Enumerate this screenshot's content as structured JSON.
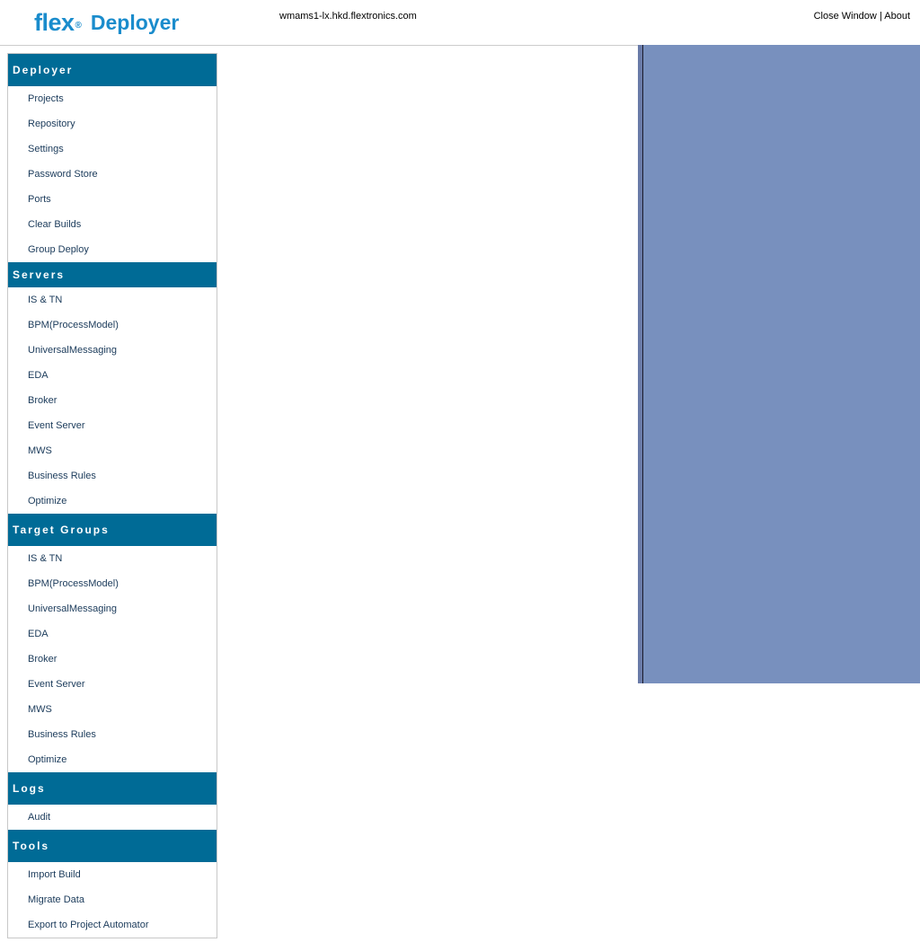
{
  "header": {
    "logo_text": "flex",
    "logo_dot": "®",
    "app_title": "Deployer",
    "hostname": "wmams1-lx.hkd.flextronics.com",
    "close_window": "Close Window",
    "separator": "|",
    "about": "About"
  },
  "colors": {
    "brand": "#1a8ccc",
    "section_header_bg": "#006b96",
    "right_panel_bg": "#7890be"
  },
  "sidebar": {
    "deployer": {
      "title": "Deployer",
      "items": [
        "Projects",
        "Repository",
        "Settings",
        "Password Store",
        "Ports",
        "Clear Builds",
        "Group Deploy"
      ]
    },
    "servers": {
      "title": "Servers",
      "items": [
        "IS & TN",
        "BPM(ProcessModel)",
        "UniversalMessaging",
        "EDA",
        "Broker",
        "Event Server",
        "MWS",
        "Business Rules",
        "Optimize"
      ]
    },
    "target_groups": {
      "title": "Target Groups",
      "items": [
        "IS & TN",
        "BPM(ProcessModel)",
        "UniversalMessaging",
        "EDA",
        "Broker",
        "Event Server",
        "MWS",
        "Business Rules",
        "Optimize"
      ]
    },
    "logs": {
      "title": "Logs",
      "items": [
        "Audit"
      ]
    },
    "tools": {
      "title": "Tools",
      "items": [
        "Import Build",
        "Migrate Data",
        "Export to Project Automator"
      ]
    }
  }
}
